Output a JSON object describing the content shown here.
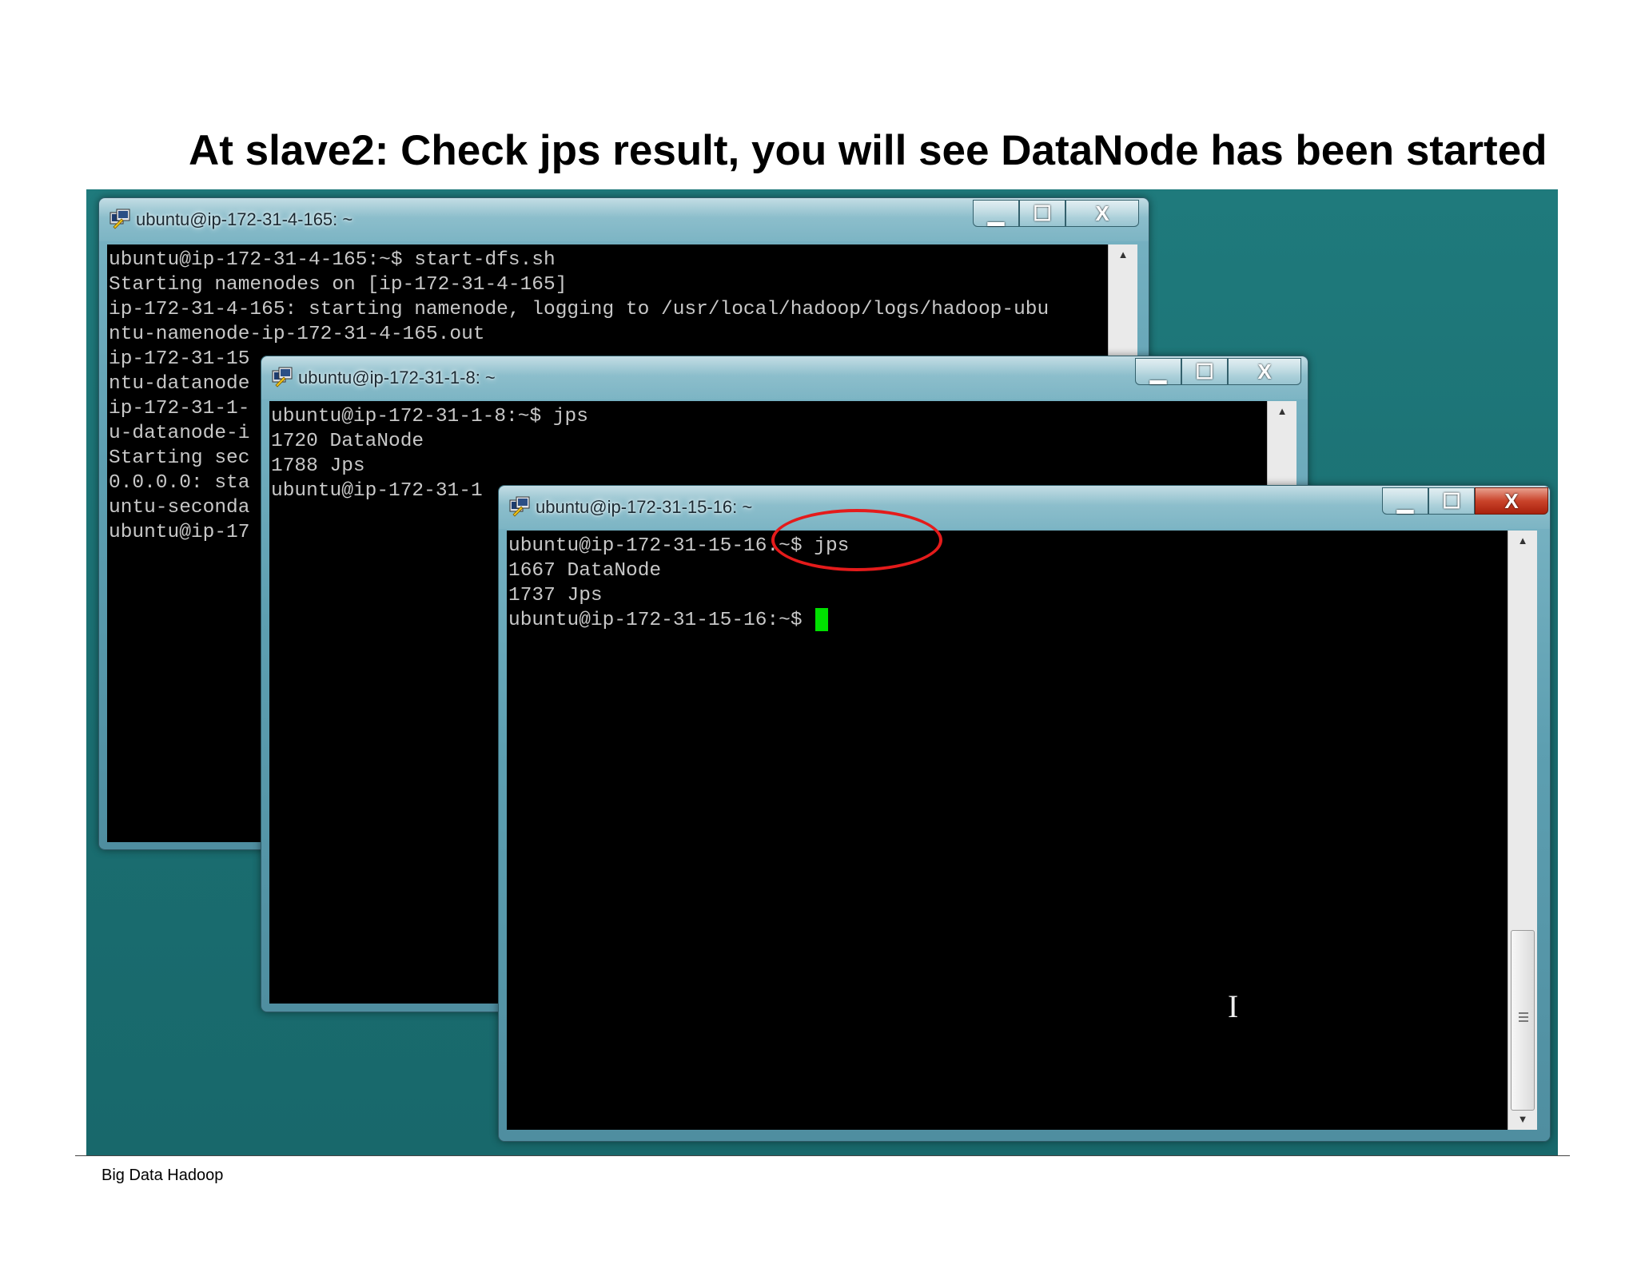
{
  "slide": {
    "title": "At slave2: Check jps result, you will see DataNode has been started",
    "footer": "Big Data Hadoop"
  },
  "windows": [
    {
      "title": "ubuntu@ip-172-31-4-165: ~",
      "lines": [
        "ubuntu@ip-172-31-4-165:~$ start-dfs.sh",
        "Starting namenodes on [ip-172-31-4-165]",
        "ip-172-31-4-165: starting namenode, logging to /usr/local/hadoop/logs/hadoop-ubu",
        "ntu-namenode-ip-172-31-4-165.out",
        "ip-172-31-15",
        "ntu-datanode",
        "ip-172-31-1-",
        "u-datanode-i",
        "Starting sec",
        "0.0.0.0: sta",
        "untu-seconda",
        "ubuntu@ip-17"
      ]
    },
    {
      "title": "ubuntu@ip-172-31-1-8: ~",
      "lines": [
        "ubuntu@ip-172-31-1-8:~$ jps",
        "1720 DataNode",
        "1788 Jps",
        "ubuntu@ip-172-31-1"
      ]
    },
    {
      "title": "ubuntu@ip-172-31-15-16: ~",
      "lines": [
        "ubuntu@ip-172-31-15-16:~$ jps",
        "1667 DataNode",
        "1737 Jps",
        "ubuntu@ip-172-31-15-16:~$ "
      ]
    }
  ],
  "controls": {
    "minimize": "▁",
    "maximize": "☐",
    "close": "X"
  },
  "colors": {
    "desktop": "#1a6d70",
    "terminal_bg": "#000000",
    "terminal_text": "#c8c8c8",
    "cursor": "#00e000",
    "annotation": "#e41b1b"
  }
}
